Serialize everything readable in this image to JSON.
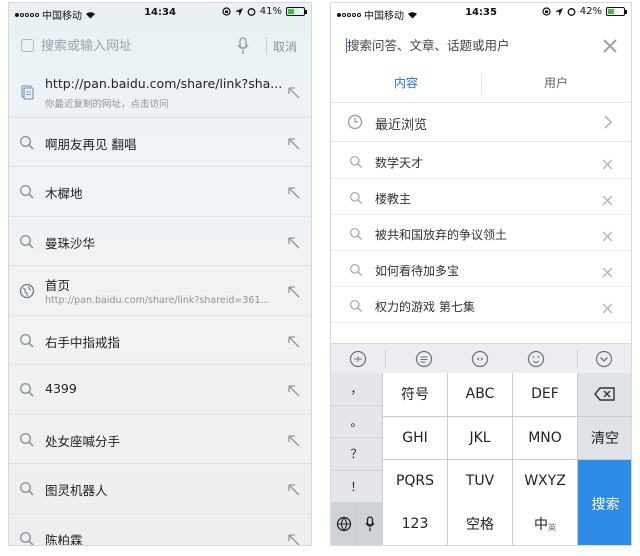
{
  "left": {
    "status": {
      "carrier": "中国移动",
      "time": "14:34",
      "battery": "41%",
      "battery_level": 0.41
    },
    "search": {
      "placeholder": "搜索或输入网址",
      "cancel_label": "取消"
    },
    "items": [
      {
        "type": "clipboard",
        "title": "http://pan.baidu.com/share/link?sha...",
        "subtitle": "你最近复制的网址，点击访问"
      },
      {
        "type": "search",
        "title": "啊朋友再见 翻唱"
      },
      {
        "type": "search",
        "title": "木樨地"
      },
      {
        "type": "search",
        "title": "曼珠沙华"
      },
      {
        "type": "web",
        "title": "首页",
        "subtitle": "http://pan.baidu.com/share/link?shareid=361..."
      },
      {
        "type": "search",
        "title": "右手中指戒指"
      },
      {
        "type": "search",
        "title": "4399"
      },
      {
        "type": "search",
        "title": "处女座喊分手"
      },
      {
        "type": "search",
        "title": "图灵机器人"
      },
      {
        "type": "search",
        "title": "陈柏霖"
      }
    ]
  },
  "right": {
    "status": {
      "carrier": "中国移动",
      "time": "14:35",
      "battery": "42%",
      "battery_level": 0.42
    },
    "search": {
      "placeholder": "搜索问答、文章、话题或用户"
    },
    "tabs": [
      {
        "label": "内容",
        "active": true
      },
      {
        "label": "用户",
        "active": false
      }
    ],
    "recent_label": "最近浏览",
    "history": [
      "数学天才",
      "楼教主",
      "被共和国放弃的争议领土",
      "如何看待加多宝",
      "权力的游戏 第七集"
    ],
    "keyboard": {
      "punct": [
        "，",
        "。",
        "？",
        "！"
      ],
      "rows": [
        [
          "符号",
          "ABC",
          "DEF"
        ],
        [
          "GHI",
          "JKL",
          "MNO"
        ],
        [
          "PQRS",
          "TUV",
          "WXYZ"
        ]
      ],
      "num_label": "123",
      "space_label": "空格",
      "lang_main": "中",
      "lang_sub": "英",
      "clear_label": "清空",
      "search_label": "搜索",
      "accent": "#2e8be6"
    }
  }
}
